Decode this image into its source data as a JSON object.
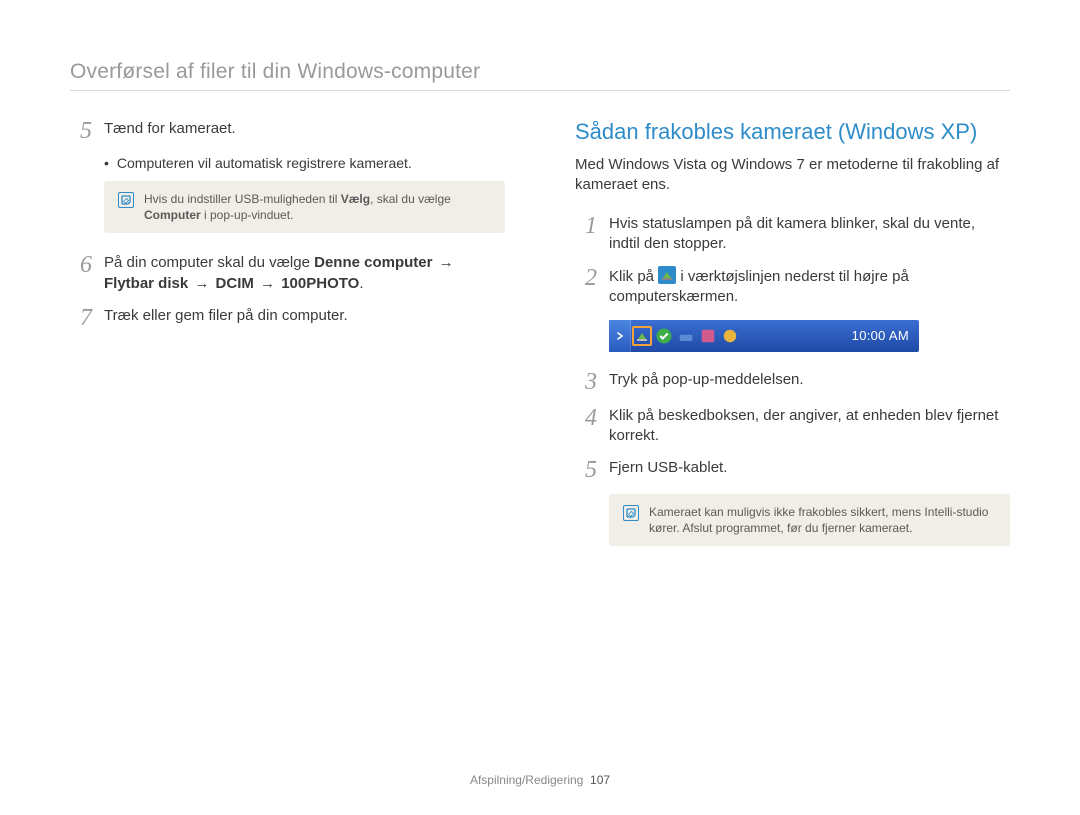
{
  "header": {
    "title": "Overførsel af filer til din Windows-computer"
  },
  "left": {
    "steps": [
      {
        "num": "5",
        "text": "Tænd for kameraet.",
        "sub_bullet": "Computeren vil automatisk registrere kameraet.",
        "note": {
          "pre": "Hvis du indstiller USB-muligheden til ",
          "bold1": "Vælg",
          "mid": ", skal du vælge ",
          "bold2": "Computer",
          "post": " i pop-up-vinduet."
        }
      },
      {
        "num": "6",
        "text_pre": "På din computer skal du vælge ",
        "bold1": "Denne computer",
        "arrow1": "→",
        "bold2": "Flytbar disk",
        "arrow2": "→",
        "bold3": "DCIM",
        "arrow3": "→",
        "bold4": "100PHOTO",
        "text_post": "."
      },
      {
        "num": "7",
        "text": "Træk eller gem filer på din computer."
      }
    ]
  },
  "right": {
    "title": "Sådan frakobles kameraet (Windows XP)",
    "intro": "Med Windows Vista og Windows 7 er metoderne til frakobling af kameraet ens.",
    "steps": [
      {
        "num": "1",
        "text": "Hvis statuslampen på dit kamera blinker, skal du vente, indtil den stopper."
      },
      {
        "num": "2",
        "text_pre": "Klik på ",
        "text_post": " i værktøjslinjen nederst til højre på computerskærmen."
      },
      {
        "num": "3",
        "text": "Tryk på pop-up-meddelelsen."
      },
      {
        "num": "4",
        "text": "Klik på beskedboksen, der angiver, at enheden blev fjernet korrekt."
      },
      {
        "num": "5",
        "text": "Fjern USB-kablet."
      }
    ],
    "tray_time": "10:00 AM",
    "note": "Kameraet kan muligvis ikke frakobles sikkert, mens Intelli-studio kører. Afslut programmet, før du fjerner kameraet."
  },
  "footer": {
    "section": "Afspilning/Redigering",
    "page": "107"
  }
}
